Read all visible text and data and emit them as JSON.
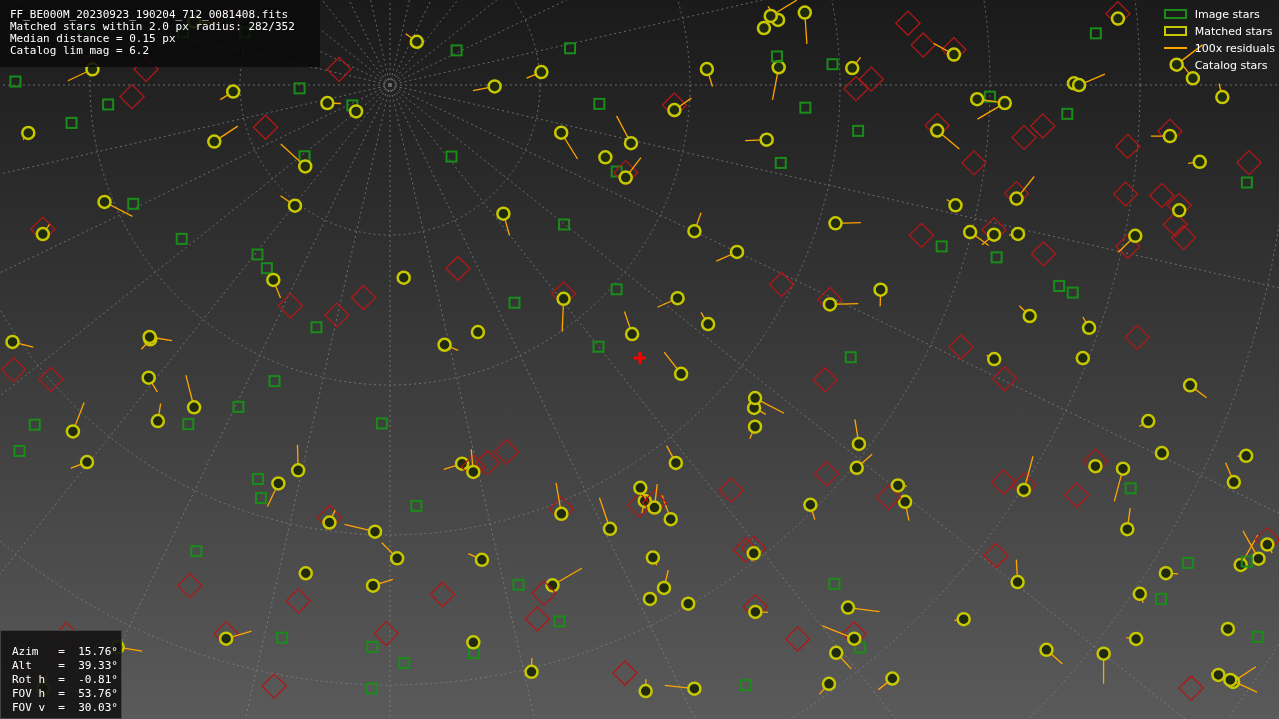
{
  "file_info": {
    "lines": [
      "FF_BE000M_20230923_190204_712_0081408.fits",
      "Matched stars within 2.0 px radius: 282/352",
      "Median distance = 0.15 px",
      "Catalog lim mag = 6.2"
    ]
  },
  "legend": [
    {
      "label": "Image stars",
      "kind": "box",
      "color": "#1a8c1a"
    },
    {
      "label": "Matched stars",
      "kind": "box",
      "color": "#c8c800"
    },
    {
      "label": "100x residuals",
      "kind": "line",
      "color": "#ffa500"
    },
    {
      "label": "Catalog stars",
      "kind": "none"
    }
  ],
  "pointing": {
    "lines": [
      "Azim   =  15.76°",
      "Alt    =  39.33°",
      "Rot h  =  -0.81°",
      "FOV h  =  53.76°",
      "FOV v  =  30.03°"
    ]
  }
}
